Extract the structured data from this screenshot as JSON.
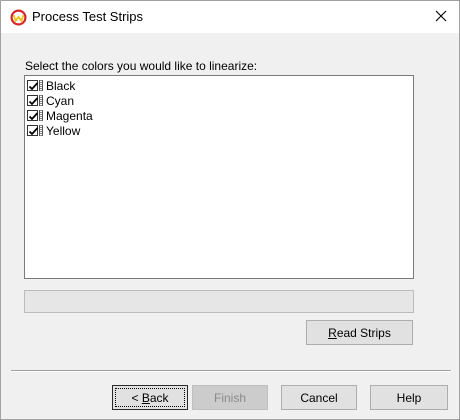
{
  "window": {
    "title": "Process Test Strips",
    "icon": "app-logo-w-icon",
    "close_icon": "close-icon"
  },
  "main": {
    "prompt": "Select the colors you would like to linearize:",
    "colors": [
      {
        "label": "Black",
        "checked": true
      },
      {
        "label": "Cyan",
        "checked": true
      },
      {
        "label": "Magenta",
        "checked": true
      },
      {
        "label": "Yellow",
        "checked": true
      }
    ],
    "progress": 0
  },
  "buttons": {
    "read_strips": {
      "accel": "R",
      "rest": "ead Strips"
    },
    "back": {
      "prefix": "< ",
      "accel": "B",
      "rest": "ack"
    },
    "finish": "Finish",
    "cancel": "Cancel",
    "help": "Help"
  },
  "colors": {
    "logo_red": "#d6262b",
    "logo_yellow": "#f3c316",
    "dialog_bg": "#f0f0f0"
  }
}
